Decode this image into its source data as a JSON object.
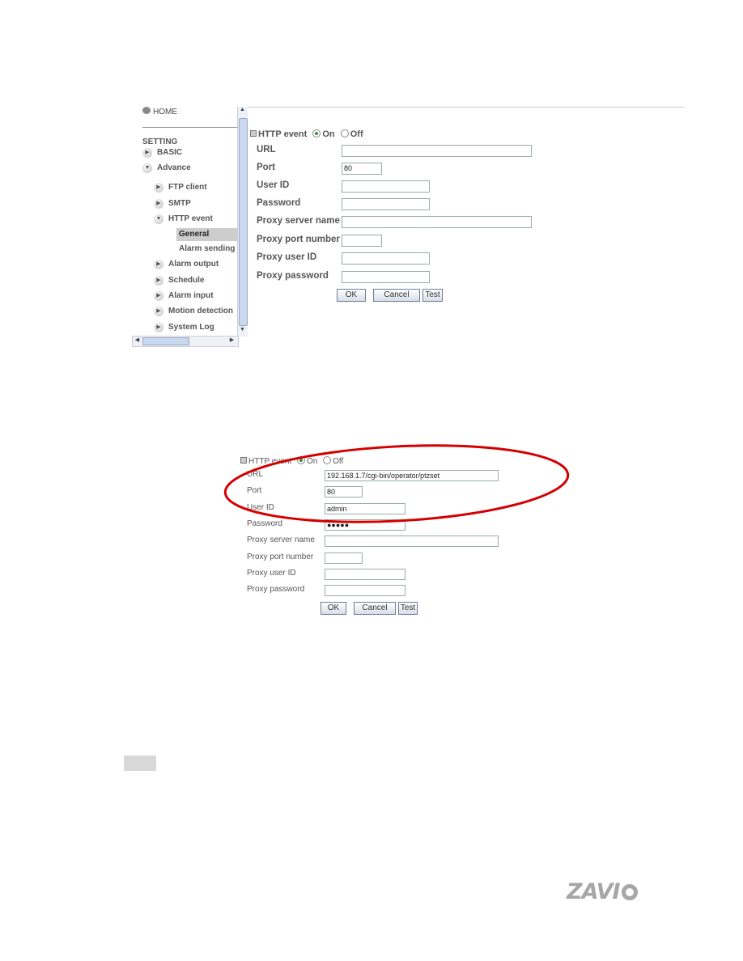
{
  "screenshot1": {
    "sidebar": {
      "home": "HOME",
      "setting": "SETTING",
      "items": [
        {
          "label": "BASIC",
          "level": 1,
          "icon": "expand-right-icon"
        },
        {
          "label": "Advance",
          "level": 1,
          "icon": "expand-down-icon"
        },
        {
          "label": "FTP client",
          "level": 2,
          "icon": "expand-right-icon"
        },
        {
          "label": "SMTP",
          "level": 2,
          "icon": "expand-right-icon"
        },
        {
          "label": "HTTP event",
          "level": 2,
          "icon": "expand-down-icon"
        },
        {
          "label": "General",
          "level": 3,
          "selected": true
        },
        {
          "label": "Alarm sending",
          "level": 3
        },
        {
          "label": "Alarm output",
          "level": 2,
          "icon": "expand-right-icon"
        },
        {
          "label": "Schedule",
          "level": 2,
          "icon": "expand-right-icon"
        },
        {
          "label": "Alarm input",
          "level": 2,
          "icon": "expand-right-icon"
        },
        {
          "label": "Motion detection",
          "level": 2,
          "icon": "expand-right-icon"
        },
        {
          "label": "System Log",
          "level": 2,
          "icon": "expand-right-icon"
        }
      ]
    },
    "form": {
      "title": "HTTP event",
      "on": "On",
      "off": "Off",
      "selected": "On",
      "fields": [
        {
          "label": "URL",
          "value": ""
        },
        {
          "label": "Port",
          "value": "80"
        },
        {
          "label": "User ID",
          "value": ""
        },
        {
          "label": "Password",
          "value": ""
        },
        {
          "label": "Proxy server name",
          "value": ""
        },
        {
          "label": "Proxy port number",
          "value": ""
        },
        {
          "label": "Proxy user ID",
          "value": ""
        },
        {
          "label": "Proxy password",
          "value": ""
        }
      ],
      "ok": "OK",
      "cancel": "Cancel",
      "test": "Test"
    }
  },
  "screenshot2": {
    "form": {
      "title": "HTTP event",
      "on": "On",
      "off": "Off",
      "selected": "On",
      "fields": [
        {
          "label": "URL",
          "value": "192.168.1.7/cgi-bin/operator/ptzset"
        },
        {
          "label": "Port",
          "value": "80"
        },
        {
          "label": "User ID",
          "value": "admin"
        },
        {
          "label": "Password",
          "value": "●●●●●"
        },
        {
          "label": "Proxy server name",
          "value": ""
        },
        {
          "label": "Proxy port number",
          "value": ""
        },
        {
          "label": "Proxy user ID",
          "value": ""
        },
        {
          "label": "Proxy password",
          "value": ""
        }
      ],
      "ok": "OK",
      "cancel": "Cancel",
      "test": "Test"
    },
    "highlight_color": "#d40000"
  },
  "logo": "ZAVIO"
}
